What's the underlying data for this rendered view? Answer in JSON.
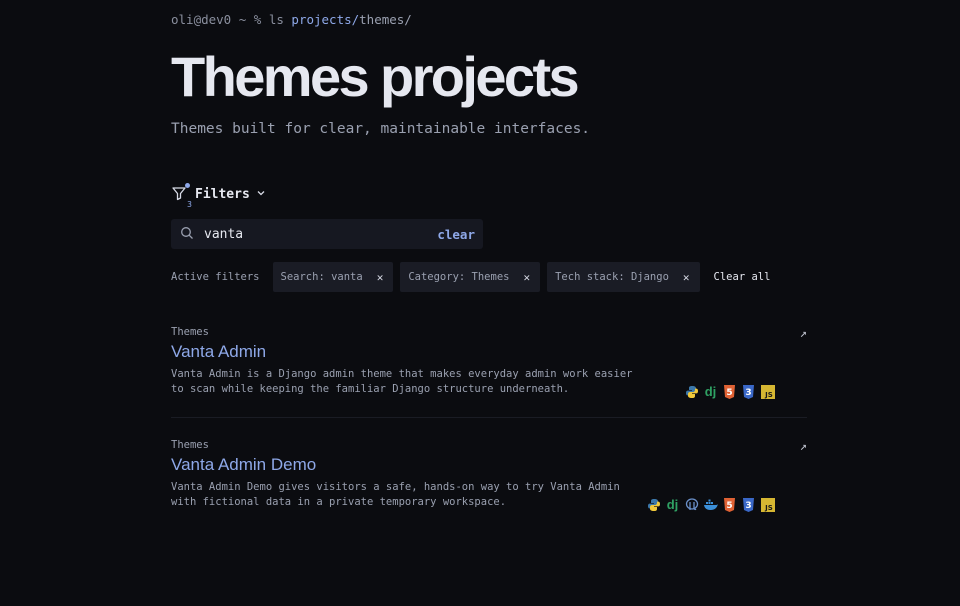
{
  "prompt": {
    "user": "oli@dev0 ~ % ls ",
    "link": "projects/",
    "rest": "themes/"
  },
  "title": "Themes projects",
  "subtitle": "Themes built for clear, maintainable interfaces.",
  "filters": {
    "label": "Filters",
    "count": "3"
  },
  "search": {
    "value": "vanta",
    "clear_label": "clear"
  },
  "active_filters": {
    "label": "Active filters",
    "chips": [
      {
        "text": "Search: vanta"
      },
      {
        "text": "Category: Themes"
      },
      {
        "text": "Tech stack: Django"
      }
    ],
    "clear_all": "Clear all"
  },
  "projects": [
    {
      "category": "Themes",
      "name": "Vanta Admin",
      "description": "Vanta Admin is a Django admin theme that makes everyday admin work easier to scan while keeping the familiar Django structure underneath.",
      "stack": [
        "python-icon",
        "django-icon",
        "html5-icon",
        "css3-icon",
        "javascript-icon"
      ]
    },
    {
      "category": "Themes",
      "name": "Vanta Admin Demo",
      "description": "Vanta Admin Demo gives visitors a safe, hands-on way to try Vanta Admin with fictional data in a private temporary workspace.",
      "stack": [
        "python-icon",
        "django-icon",
        "postgresql-icon",
        "docker-icon",
        "html5-icon",
        "css3-icon",
        "javascript-icon"
      ]
    }
  ],
  "colors": {
    "accent": "#8ea8e8",
    "bg": "#0b0c10",
    "chip_bg": "#1a1c25"
  }
}
